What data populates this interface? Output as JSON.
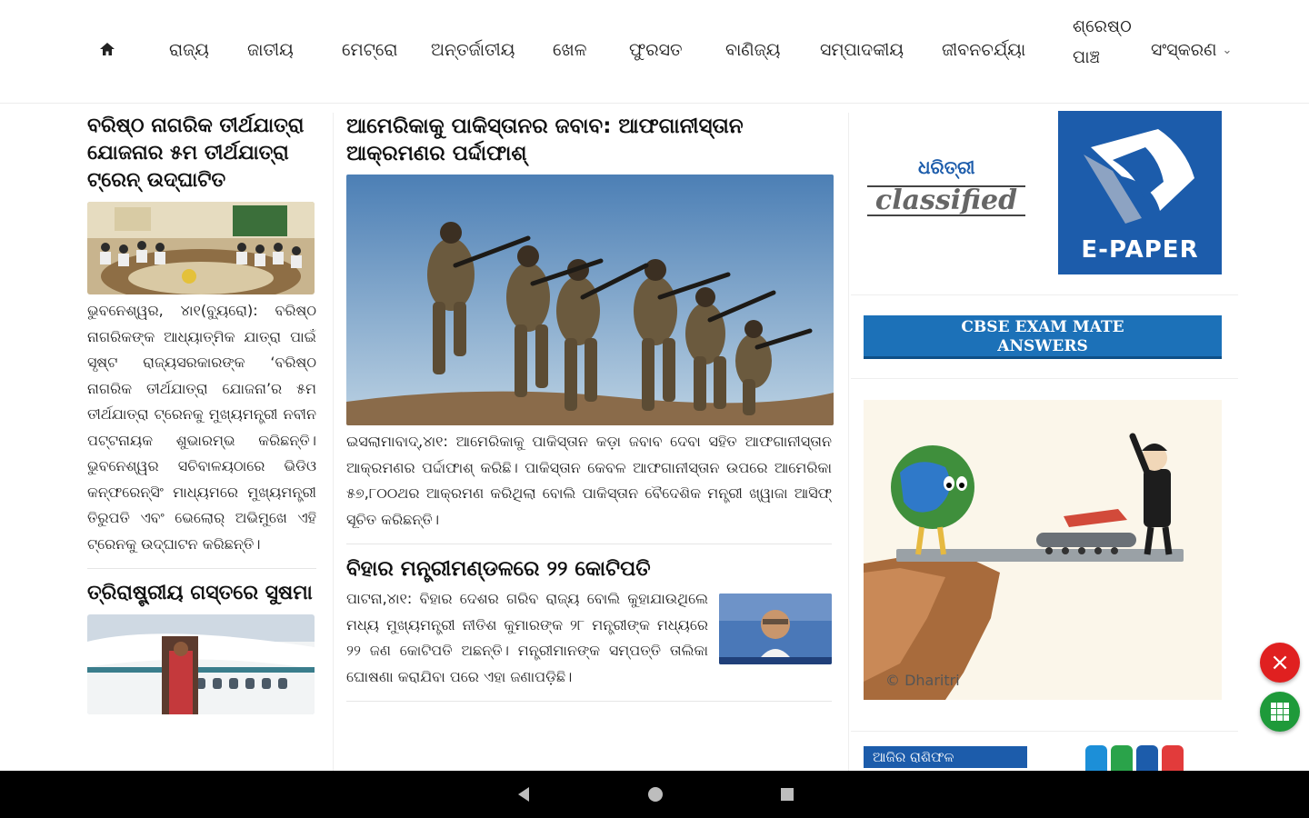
{
  "nav": {
    "items": [
      "ରାଜ୍ୟ",
      "ଜାତୀୟ",
      "ମେଟ୍ରୋ",
      "ଅନ୍ତର୍ଜାତୀୟ",
      "ଖେଳ",
      "ଫୁରସତ",
      "ବାଣିଜ୍ୟ",
      "ସମ୍ପାଦକୀୟ",
      "ଜୀବନଚର୍ଯ୍ୟା"
    ],
    "best_line1": "ଶ୍ରେଷ୍ଠ",
    "best_line2": "ପାଞ୍ଚ",
    "edition": "ସଂସ୍କରଣ"
  },
  "left": {
    "story1": {
      "headline": "ବରିଷ୍ଠ ନାଗରିକ ତୀର୍ଥଯାତ୍ରା ଯୋଜନାର ୫ମ ତୀର୍ଥଯାତ୍ରା ଟ୍ରେନ୍ ଉଦ୍‌ଘାଟିତ",
      "body": "ଭୁବନେଶ୍ୱର, ୪ା୧(ବ୍ୟୁରୋ): ବରିଷ୍ଠ ନାଗରିକଙ୍କ ଆଧ୍ୟାତ୍ମିକ ଯାତ୍ରା ପାଇଁ ସୃଷ୍ଟ ରାଜ୍ୟସରକାରଙ୍କ ‘ବରିଷ୍ଠ ନାଗରିକ ତୀର୍ଥଯାତ୍ରା ଯୋଜନା’ର ୫ମ ତୀର୍ଥଯାତ୍ରା ଟ୍ରେନକୁ ମୁଖ୍ୟମନ୍ତ୍ରୀ ନବୀନ ପଟ୍ଟନାୟକ ଶୁଭାରମ୍ଭ କରିଛନ୍ତି। ଭୁବନେଶ୍ୱର ସଚିବାଳୟଠାରେ ଭିଡିଓ କନ୍‌ଫରେନ୍ସିଂ ମାଧ୍ୟମରେ ମୁଖ୍ୟମନ୍ତ୍ରୀ ତିରୁପତି ଏବଂ ଭେଲୋର୍‌ ଅଭିମୁଖେ ଏହି ଟ୍ରେନକୁ ଉଦ୍‌ଘାଟନ କରିଛନ୍ତି।"
    },
    "story2": {
      "headline": "ତ୍ରିରାଷ୍ଟ୍ରୀୟ ଗସ୍ତରେ ସୁଷମା"
    }
  },
  "mid": {
    "story1": {
      "headline": "ଆମେରିକାକୁ ପାକିସ୍ତାନର ଜବାବ: ଆଫଗାନୀସ୍ତାନ ଆକ୍ରମଣର ପର୍ଦ୍ଦାଫାଶ୍‌",
      "body": "ଇସଲାମାବାଦ୍,୪ା୧: ଆମେରିକାକୁ ପାକିସ୍ତାନ କଡ଼ା ଜବାବ ଦେବା ସହିତ ଆଫଗାନୀସ୍ତାନ ଆକ୍ରମଣର ପର୍ଦ୍ଦାଫାଶ୍ କରିଛି। ପାକିସ୍ତାନ କେବଳ ଆଫଗାନୀସ୍ତାନ ଉପରେ ଆମେରିକା ୫୭,୮୦୦ଥର ଆକ୍ରମଣ କରିଥିଲା ବୋଲି ପାକିସ୍ତାନ ବୈଦେଶିକ ମନ୍ତ୍ରୀ ଖ୍ୱାଜା ଆସିଫ୍ ସୂଚିତ କରିଛନ୍ତି।"
    },
    "story2": {
      "headline": "ବିହାର ମନ୍ତ୍ରୀମଣ୍ଡଳରେ ୨୨ କୋଟିପତି",
      "body": "ପାଟନା,୪ା୧: ବିହାର ଦେଶର ଗରିବ ରାଜ୍ୟ ବୋଲି କୁହାଯାଉଥିଲେ ମଧ୍ୟ ମୁଖ୍ୟମନ୍ତ୍ରୀ ନୀତିଶ କୁମାରଙ୍କ ୨୮ ମନ୍ତ୍ରୀଙ୍କ ମଧ୍ୟରେ ୨୨ ଜଣ କୋଟିପତି ଅଛନ୍ତି। ମନ୍ତ୍ରୀମାନଙ୍କ ସମ୍ପତ୍ତି ତାଲିକା ଘୋଷଣା କରାଯିବା ପରେ ଏହା ଜଣାପଡ଼ିଛି।"
    }
  },
  "right": {
    "classified_top": "ଧରିତ୍ରୀ",
    "classified_bottom": "classified",
    "epaper_label": "E-PAPER",
    "cbse_line1": "CBSE EXAM MATE",
    "cbse_line2": "ANSWERS",
    "cartoon_credit": "© Dharitri",
    "bottom_tag": "ଆଜିର ରାଶିଫଳ"
  },
  "colors": {
    "brand_blue": "#1c5cab",
    "cbse_blue": "#1c71b8",
    "close_red": "#e02020",
    "grid_green": "#1e9a3a"
  },
  "icons": [
    "home-icon",
    "chevron-down-icon",
    "close-icon",
    "grid-icon",
    "back-icon",
    "home-nav-icon",
    "recents-icon"
  ]
}
